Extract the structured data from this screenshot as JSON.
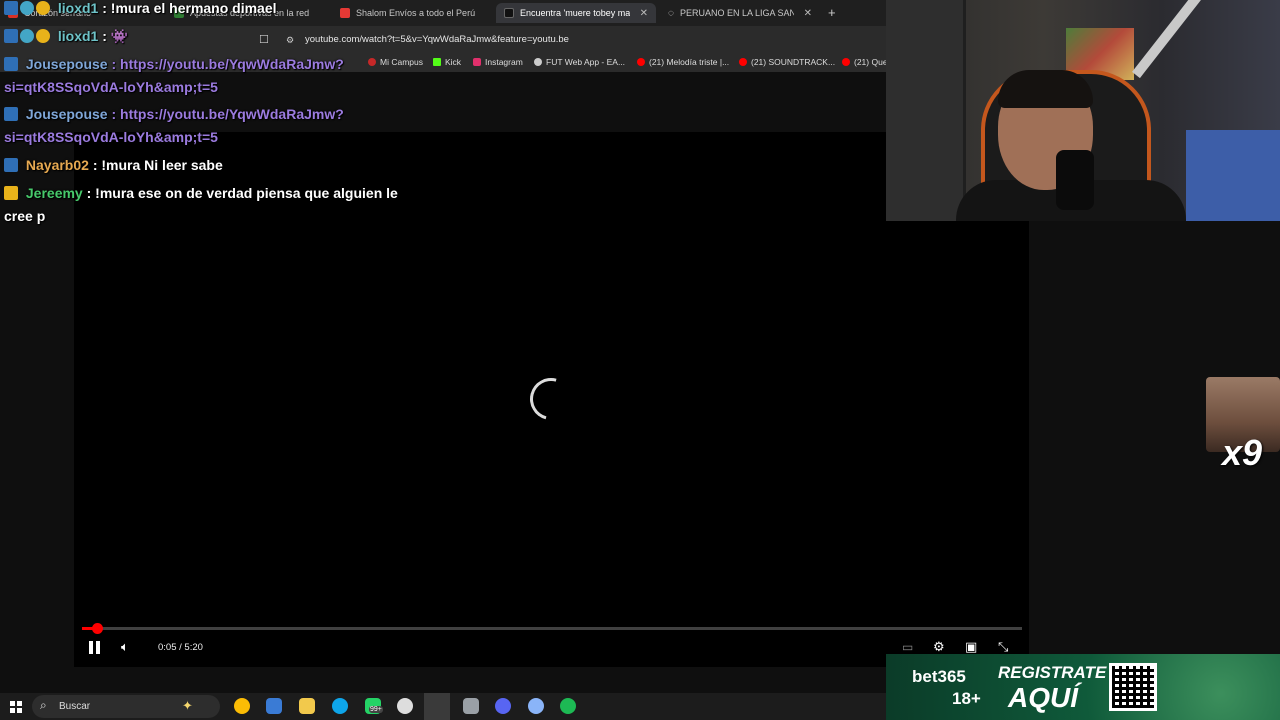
{
  "browser": {
    "tabs": [
      {
        "label": "Corazón serrano",
        "color": "#d93025"
      },
      {
        "label": "Apuestas deportivas en la red",
        "color": "#2e7d32"
      },
      {
        "label": "Shalom Envíos a todo el Perú",
        "color": "#e53935"
      },
      {
        "label": "Encuentra 'muere tobey maguire'",
        "color": "#111111"
      },
      {
        "label": "PERUANO EN LA LIGA SANTANDER",
        "color": "#ffffff"
      }
    ],
    "url": "youtube.com/watch?t=5&v=YqwWdaRaJmw&feature=youtu.be",
    "bookmarks": [
      {
        "label": "Mi Campus",
        "color": "#c62828"
      },
      {
        "label": "Kick",
        "color": "#53fc18"
      },
      {
        "label": "Instagram",
        "color": "#e1306c"
      },
      {
        "label": "FUT Web App - EA...",
        "color": "#cccccc"
      },
      {
        "label": "(21) Melodía triste |...",
        "color": "#ff0000"
      },
      {
        "label": "(21) SOUNDTRACK...",
        "color": "#ff0000"
      },
      {
        "label": "(21) Que",
        "color": "#ff0000"
      }
    ]
  },
  "chat": [
    {
      "user": "lioxd1",
      "user_color": "#6ec3c8",
      "text": ": !mura el hermano dimael"
    },
    {
      "user": "lioxd1",
      "user_color": "#6ec3c8",
      "text": ": 👾"
    },
    {
      "user": "Jousepouse",
      "user_color": "#7fa7d9",
      "text": ": https://youtu.be/YqwWdaRaJmw?"
    },
    {
      "user": "",
      "user_color": "#9b7bdf",
      "text": "si=qtK8SSqoVdA-loYh&amp;t=5"
    },
    {
      "user": "Jousepouse",
      "user_color": "#7fa7d9",
      "text": ": https://youtu.be/YqwWdaRaJmw?"
    },
    {
      "user": "",
      "user_color": "#9b7bdf",
      "text": "si=qtK8SSqoVdA-loYh&amp;t=5"
    },
    {
      "user": "Nayarb02",
      "user_color": "#e6a951",
      "text": ": !mura Ni leer sabe"
    },
    {
      "user": "Jereemy",
      "user_color": "#47c96b",
      "text": ": !mura ese on de verdad piensa que alguien le"
    },
    {
      "user": "",
      "user_color": "#ffffff",
      "text": "cree p"
    }
  ],
  "player": {
    "time": "0:05 / 5:20",
    "progress_fraction": 0.016
  },
  "emote": {
    "multiplier": "x9"
  },
  "ad": {
    "brand": "bet365",
    "age": "18+",
    "cta_top": "REGISTRATE",
    "cta_bottom": "AQUÍ"
  },
  "taskbar": {
    "search_placeholder": "Buscar",
    "apps": [
      {
        "name": "chrome-icon",
        "color": "#fbbc05"
      },
      {
        "name": "store-icon",
        "color": "#3a7bd5"
      },
      {
        "name": "folder-icon",
        "color": "#f2c94c"
      },
      {
        "name": "edge-icon",
        "color": "#0ea5e9"
      },
      {
        "name": "whatsapp-icon",
        "color": "#25d366"
      },
      {
        "name": "obs-icon",
        "color": "#dddddd"
      },
      {
        "name": "brave-icon",
        "color": "#fb542b"
      },
      {
        "name": "app-icon",
        "color": "#9aa0a6"
      },
      {
        "name": "discord-icon",
        "color": "#5865f2"
      },
      {
        "name": "settings-icon",
        "color": "#8ab4f8"
      },
      {
        "name": "spotify-icon",
        "color": "#1db954"
      }
    ],
    "badge": "99+"
  }
}
